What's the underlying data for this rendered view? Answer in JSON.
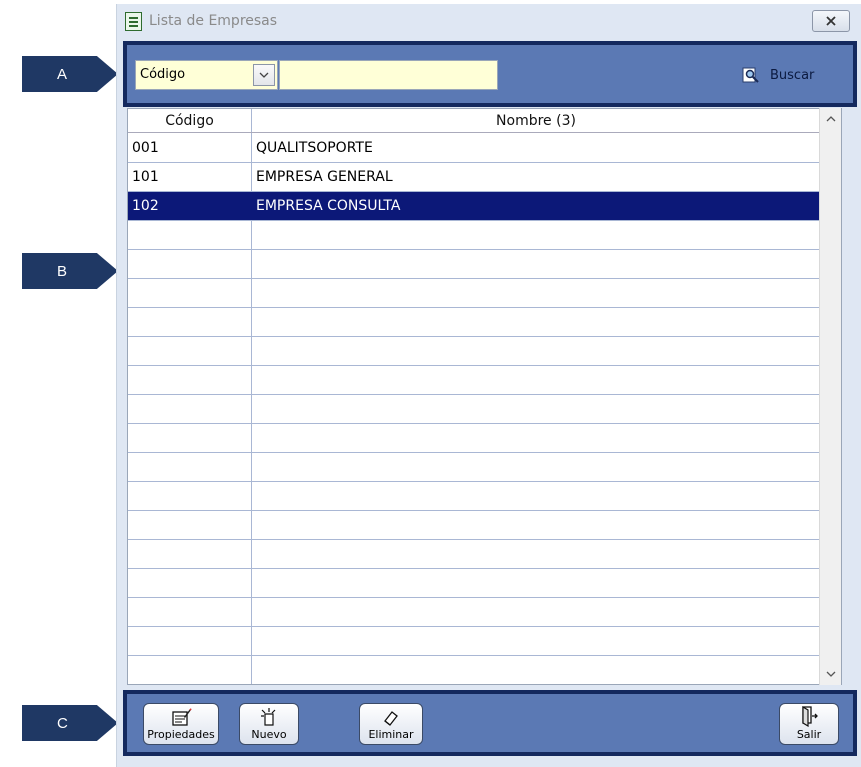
{
  "callouts": {
    "a": "A",
    "b": "B",
    "c": "C"
  },
  "window": {
    "title": "Lista de Empresas",
    "close_glyph": "⊠"
  },
  "search": {
    "field_selected": "Código",
    "query_value": "",
    "buscar_label": "Buscar"
  },
  "grid": {
    "columns": [
      "Código",
      "Nombre (3)"
    ],
    "rows": [
      {
        "code": "001",
        "name": "QUALITSOPORTE"
      },
      {
        "code": "101",
        "name": "EMPRESA GENERAL"
      },
      {
        "code": "102",
        "name": "EMPRESA CONSULTA"
      }
    ],
    "selected_row": 2
  },
  "toolbar": {
    "propiedades_label": "Propiedades",
    "nuevo_label": "Nuevo",
    "eliminar_label": "Eliminar",
    "salir_label": "Salir"
  },
  "colors": {
    "panel": "#5b79b4",
    "panel_border": "#14295e",
    "selection": "#0c1878",
    "input_bg": "#ffffd7",
    "callout": "#1f3864"
  }
}
